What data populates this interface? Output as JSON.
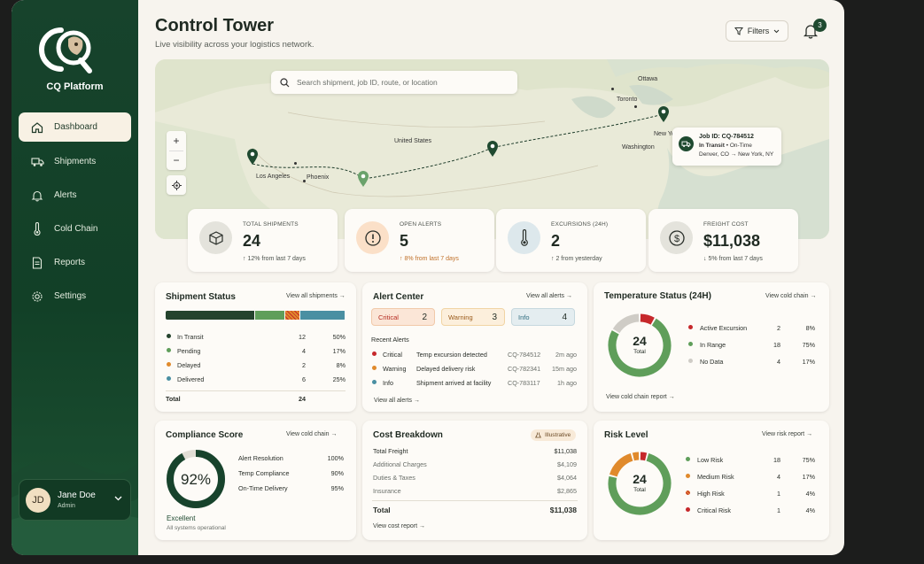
{
  "sidebar": {
    "brand": "CQ Platform",
    "items": [
      {
        "label": "Dashboard",
        "icon": "home-icon",
        "active": true
      },
      {
        "label": "Shipments",
        "icon": "truck-icon"
      },
      {
        "label": "Alerts",
        "icon": "bell-icon"
      },
      {
        "label": "Cold Chain",
        "icon": "thermometer-icon"
      },
      {
        "label": "Reports",
        "icon": "document-icon"
      },
      {
        "label": "Settings",
        "icon": "gear-icon"
      }
    ],
    "user": {
      "initials": "JD",
      "name": "Jane Doe",
      "role": "Admin"
    }
  },
  "header": {
    "title": "Control Tower",
    "subtitle": "Live visibility across your logistics network.",
    "filters_label": "Filters",
    "notification_count": "3"
  },
  "map": {
    "search_placeholder": "Search shipment, job ID, route, or location",
    "cities": {
      "ottawa": "Ottawa",
      "toronto": "Toronto",
      "new_york": "New York",
      "washington": "Washington",
      "united_states": "United States",
      "los_angeles": "Los Angeles",
      "phoenix": "Phoenix"
    },
    "job": {
      "id": "Job ID: CQ-784512",
      "status": "In Transit",
      "eta": "On-Time",
      "origin": "Denver, CO",
      "destination": "New York, NY"
    }
  },
  "stats": [
    {
      "label": "TOTAL SHIPMENTS",
      "value": "24",
      "change": "12% from last 7 days",
      "icon": "box-icon"
    },
    {
      "label": "OPEN ALERTS",
      "value": "5",
      "change": "8% from last 7 days",
      "icon": "alert-icon"
    },
    {
      "label": "EXCURSIONS (24H)",
      "value": "2",
      "change": "2 from yesterday",
      "icon": "thermometer-icon"
    },
    {
      "label": "FREIGHT COST",
      "value": "$11,038",
      "change": "5% from last 7 days",
      "icon": "dollar-icon"
    }
  ],
  "shipment_status": {
    "title": "Shipment Status",
    "link": "View all shipments",
    "rows": [
      {
        "label": "In Transit",
        "count": "12",
        "pct": "50%",
        "value": 12
      },
      {
        "label": "Pending",
        "count": "4",
        "pct": "17%",
        "value": 4
      },
      {
        "label": "Delayed",
        "count": "2",
        "pct": "8%",
        "value": 2
      },
      {
        "label": "Delivered",
        "count": "6",
        "pct": "25%",
        "value": 6
      }
    ],
    "total_label": "Total",
    "total": "24"
  },
  "alert_center": {
    "title": "Alert Center",
    "link": "View all alerts",
    "chips": [
      {
        "label": "Critical",
        "count": "2"
      },
      {
        "label": "Warning",
        "count": "3"
      },
      {
        "label": "Info",
        "count": "4"
      }
    ],
    "recent_label": "Recent Alerts",
    "recent": [
      {
        "level": "Critical",
        "text": "Temp excursion detected",
        "id": "CQ-784512",
        "time": "2m ago"
      },
      {
        "level": "Warning",
        "text": "Delayed delivery risk",
        "id": "CQ-782341",
        "time": "15m ago"
      },
      {
        "level": "Info",
        "text": "Shipment arrived at facility",
        "id": "CQ-783117",
        "time": "1h ago"
      }
    ],
    "footer_link": "View all alerts"
  },
  "temperature": {
    "title": "Temperature Status (24H)",
    "link": "View cold chain",
    "center_value": "24",
    "center_label": "Total",
    "rows": [
      {
        "label": "Active Excursion",
        "count": "2",
        "pct": "8%",
        "value": 2
      },
      {
        "label": "In Range",
        "count": "18",
        "pct": "75%",
        "value": 18
      },
      {
        "label": "No Data",
        "count": "4",
        "pct": "17%",
        "value": 4
      }
    ],
    "footer_link": "View cold chain report"
  },
  "compliance": {
    "title": "Compliance Score",
    "link": "View cold chain",
    "score": "92%",
    "score_value": 92,
    "rating": "Excellent",
    "note": "All systems operational",
    "rows": [
      {
        "label": "Alert Resolution",
        "value": "100%"
      },
      {
        "label": "Temp Compliance",
        "value": "90%"
      },
      {
        "label": "On-Time Delivery",
        "value": "95%"
      }
    ]
  },
  "cost": {
    "title": "Cost Breakdown",
    "badge": "Illustrative",
    "rows": [
      {
        "label": "Total Freight",
        "value": "$11,038"
      },
      {
        "label": "Additional Charges",
        "value": "$4,109"
      },
      {
        "label": "Duties & Taxes",
        "value": "$4,064"
      },
      {
        "label": "Insurance",
        "value": "$2,865"
      }
    ],
    "total_label": "Total",
    "total": "$11,038",
    "footer_link": "View cost report"
  },
  "risk": {
    "title": "Risk Level",
    "link": "View risk report",
    "center_value": "24",
    "center_label": "Total",
    "rows": [
      {
        "label": "Low Risk",
        "count": "18",
        "pct": "75%",
        "value": 18
      },
      {
        "label": "Medium Risk",
        "count": "4",
        "pct": "17%",
        "value": 4
      },
      {
        "label": "High Risk",
        "count": "1",
        "pct": "4%",
        "value": 1
      },
      {
        "label": "Critical Risk",
        "count": "1",
        "pct": "4%",
        "value": 1
      }
    ]
  },
  "colors": {
    "brand": "#17432c",
    "green": "#5f9e5a",
    "dark_green": "#24432d",
    "orange": "#e08a2c",
    "red": "#c6282b",
    "teal": "#4a8fa2",
    "gray": "#cfccc6"
  }
}
